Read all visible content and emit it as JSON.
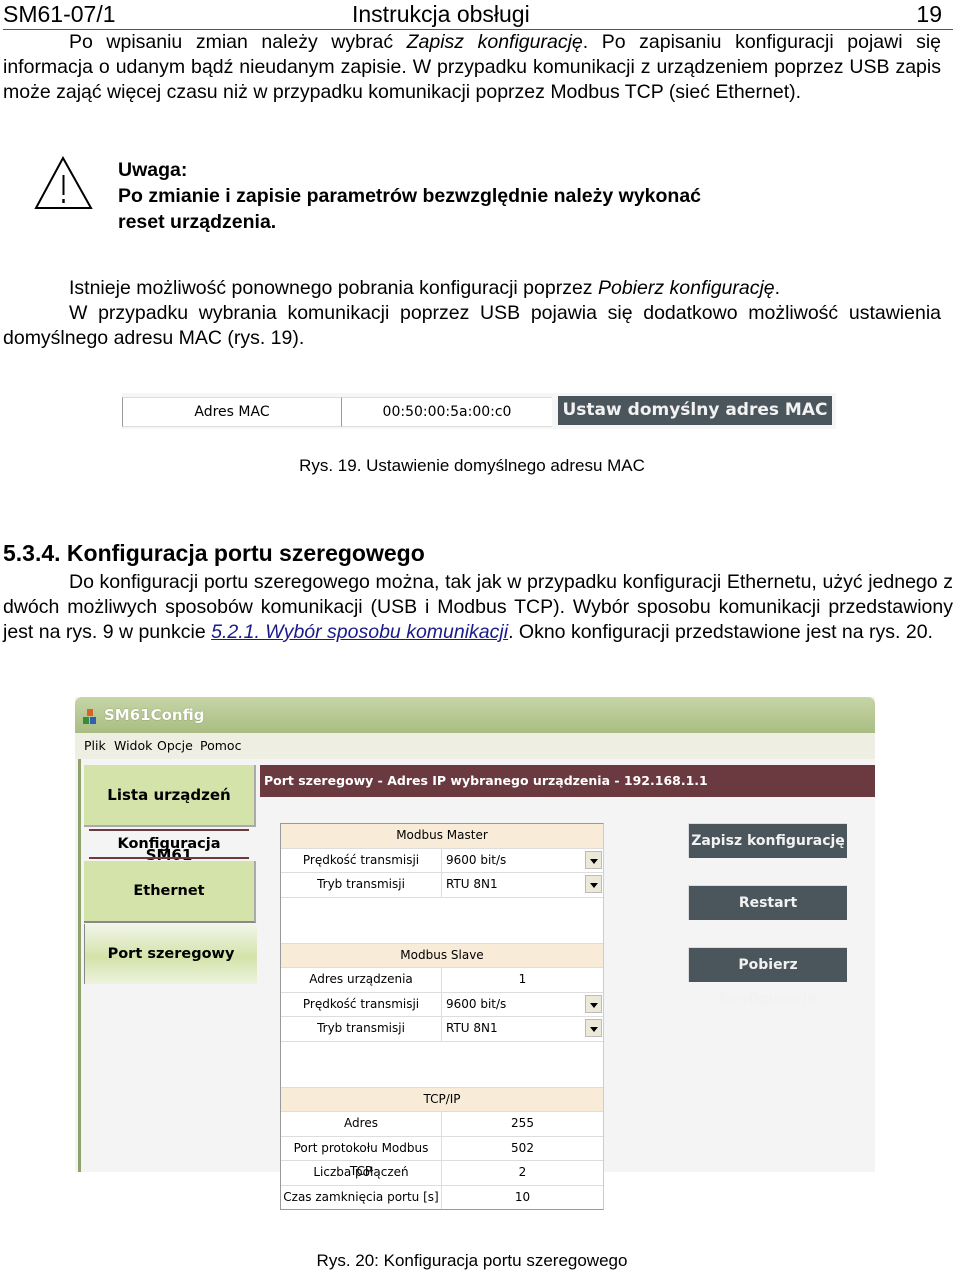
{
  "header": {
    "doc_code": "SM61-07/1",
    "doc_title": "Instrukcja obsługi",
    "page_number": "19"
  },
  "intro": {
    "p1_a": "Po wpisaniu zmian należy wybrać ",
    "p1_em": "Zapisz konfigurację",
    "p1_b": ". Po zapisaniu konfiguracji pojawi się informacja o udanym bądź nieudanym zapisie. W przypadku komunikacji z urządzeniem poprzez USB zapis może zająć więcej czasu niż w przypadku komunikacji poprzez Modbus TCP (sieć Ethernet)."
  },
  "warning": {
    "icon": "warning-triangle-icon",
    "title": "Uwaga:",
    "line1": "Po zmianie i zapisie parametrów bezwzględnie należy wykonać",
    "line2": "reset urządzenia."
  },
  "para2": {
    "a": "Istnieje możliwość ponownego pobrania konfiguracji poprzez ",
    "em": "Pobierz konfigurację",
    "b": "."
  },
  "para3": "W przypadku wybrania komunikacji poprzez USB pojawia się dodatkowo możliwość ustawienia  domyślnego adresu MAC (rys. 19).",
  "mac": {
    "label": "Adres MAC",
    "value": "00:50:00:5a:00:c0",
    "button": "Ustaw domyślny adres MAC",
    "caption": "Rys. 19. Ustawienie domyślnego adresu MAC"
  },
  "section": {
    "heading": "5.3.4. Konfiguracja portu szeregowego",
    "p_a": "Do konfiguracji portu szeregowego można, tak jak w przypadku konfiguracji Ethernetu, użyć jednego z dwóch możliwych sposobów komunikacji (USB i Modbus TCP). Wybór sposobu komunikacji przedstawiony jest na rys. 9 w punkcie ",
    "link": "5.2.1. Wybór sposobu komunikacji",
    "p_b": ". Okno konfiguracji przedstawione jest na rys. 20."
  },
  "app": {
    "title": "SM61Config",
    "menu": [
      "Plik",
      "Widok",
      "Opcje",
      "Pomoc"
    ],
    "sidebar": {
      "device_list": "Lista urządzeń SM61",
      "group_label": "Konfiguracja",
      "ethernet": "Ethernet",
      "serial": "Port szeregowy"
    },
    "banner": "Port szeregowy - Adres IP wybranego urządzenia - 192.168.1.1",
    "sections": {
      "master": "Modbus Master",
      "slave": "Modbus Slave",
      "tcpip": "TCP/IP"
    },
    "master_rows": [
      {
        "label": "Prędkość transmisji",
        "value": "9600 bit/s"
      },
      {
        "label": "Tryb transmisji",
        "value": "RTU 8N1"
      }
    ],
    "slave_rows": [
      {
        "label": "Adres urządzenia",
        "value": "1"
      },
      {
        "label": "Prędkość transmisji",
        "value": "9600 bit/s"
      },
      {
        "label": "Tryb transmisji",
        "value": "RTU 8N1"
      }
    ],
    "tcp_rows": [
      {
        "label": "Adres",
        "value": "255"
      },
      {
        "label": "Port protokołu Modbus TCP",
        "value": "502"
      },
      {
        "label": "Liczba połączeń",
        "value": "2"
      },
      {
        "label": "Czas zamknięcia portu [s]",
        "value": "10"
      }
    ],
    "buttons": {
      "save": "Zapisz konfigurację",
      "restart": "Restart",
      "load": "Pobierz konfigurację"
    },
    "colors": {
      "banner": "#6b3a40",
      "button": "#4a565c",
      "sidebar_green": "#d4e3a9",
      "section_header": "#f8ecd8"
    }
  },
  "figure_caption": "Rys. 20: Konfiguracja portu szeregowego"
}
